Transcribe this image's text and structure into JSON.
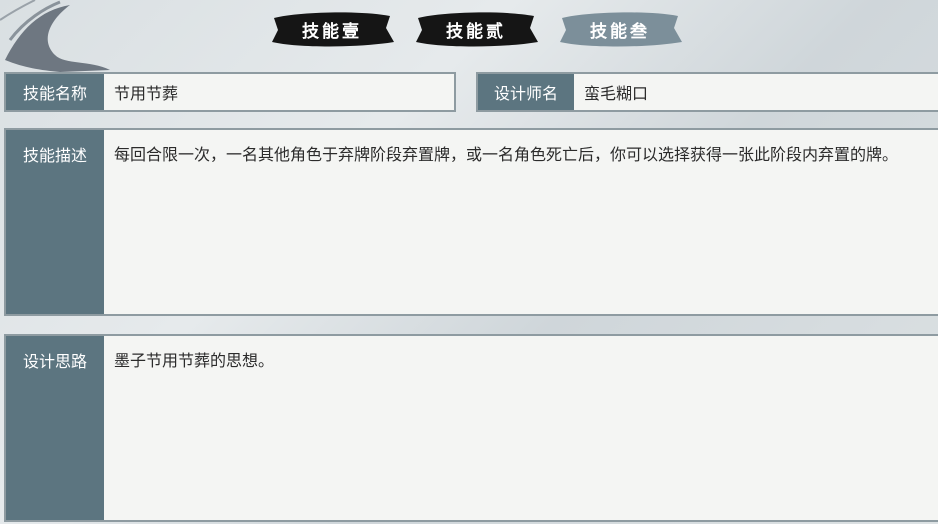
{
  "tabs": [
    {
      "label": "技能壹",
      "color": "#151515"
    },
    {
      "label": "技能贰",
      "color": "#151515"
    },
    {
      "label": "技能叁",
      "color": "#7c8f9a"
    }
  ],
  "skill_name": {
    "label": "技能名称",
    "value": "节用节葬"
  },
  "designer": {
    "label": "设计师名",
    "value": "蛮毛糊口"
  },
  "description": {
    "label": "技能描述",
    "value": "每回合限一次，一名其他角色于弃牌阶段弃置牌，或一名角色死亡后，你可以选择获得一张此阶段内弃置的牌。"
  },
  "design_idea": {
    "label": "设计思路",
    "value": "墨子节用节葬的思想。"
  }
}
